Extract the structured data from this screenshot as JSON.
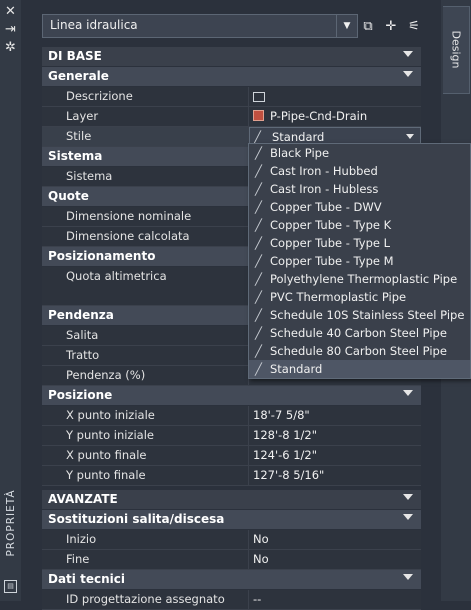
{
  "window": {
    "side_title": "PROPRIETÀ",
    "tab": "Design",
    "close_glyph": "✕",
    "pin_glyph": "⇥",
    "settings_glyph": "✲"
  },
  "selector": {
    "value": "Linea idraulica"
  },
  "toolbar": [
    "add-selection-icon",
    "select-objects-icon",
    "quick-select-icon"
  ],
  "sections": {
    "basic": "DI BASE",
    "generale": "Generale",
    "sistema": "Sistema",
    "quote": "Quote",
    "posizionamento": "Posizionamento",
    "pendenza": "Pendenza",
    "posizione": "Posizione",
    "avanzate": "AVANZATE",
    "sostituzioni": "Sostituzioni salita/discesa",
    "dati": "Dati tecnici"
  },
  "props": {
    "descrizione": {
      "k": "Descrizione",
      "v": ""
    },
    "layer": {
      "k": "Layer",
      "v": "P-Pipe-Cnd-Drain"
    },
    "stile": {
      "k": "Stile",
      "v": "Standard"
    },
    "sistema": {
      "k": "Sistema"
    },
    "dim_nom": {
      "k": "Dimensione nominale"
    },
    "dim_calc": {
      "k": "Dimensione calcolata"
    },
    "quota": {
      "k": "Quota altimetrica"
    },
    "salita": {
      "k": "Salita"
    },
    "tratto": {
      "k": "Tratto"
    },
    "pend": {
      "k": "Pendenza (%)"
    },
    "xi": {
      "k": "X punto iniziale",
      "v": "18'-7 5/8\""
    },
    "yi": {
      "k": "Y punto iniziale",
      "v": "128'-8 1/2\""
    },
    "xf": {
      "k": "X punto finale",
      "v": "124'-6 1/2\""
    },
    "yf": {
      "k": "Y punto finale",
      "v": "127'-8 5/16\""
    },
    "inizio": {
      "k": "Inizio",
      "v": "No"
    },
    "fine": {
      "k": "Fine",
      "v": "No"
    },
    "idprog": {
      "k": "ID progettazione assegnato",
      "v": "--"
    }
  },
  "style_options": [
    "Black Pipe",
    "Cast Iron - Hubbed",
    "Cast Iron - Hubless",
    "Copper Tube - DWV",
    "Copper Tube - Type K",
    "Copper Tube - Type L",
    "Copper Tube - Type M",
    "Polyethylene Thermoplastic Pipe",
    "PVC Thermoplastic Pipe",
    "Schedule 10S Stainless Steel Pipe",
    "Schedule 40 Carbon Steel Pipe",
    "Schedule 80 Carbon Steel Pipe",
    "Standard"
  ],
  "selected_style": "Standard",
  "colors": {
    "layer_swatch": "#c05040",
    "accent_select": "#4e5665"
  }
}
